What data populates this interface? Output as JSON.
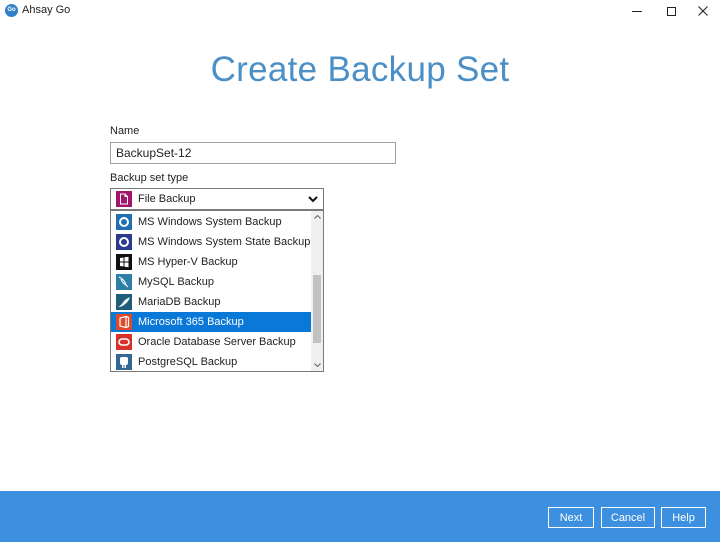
{
  "window": {
    "logo_text": "Go",
    "title": "Ahsay Go"
  },
  "page": {
    "title": "Create Backup Set"
  },
  "form": {
    "name_label": "Name",
    "name_value": "BackupSet-12",
    "type_label": "Backup set type",
    "type_selected": "File Backup",
    "type_selected_icon": "file-icon"
  },
  "dropdown": {
    "options": [
      {
        "label": "MS Windows System Backup",
        "icon": "windows-system-icon",
        "selected": false
      },
      {
        "label": "MS Windows System State Backup",
        "icon": "windows-system-state-icon",
        "selected": false
      },
      {
        "label": "MS Hyper-V Backup",
        "icon": "hyper-v-icon",
        "selected": false
      },
      {
        "label": "MySQL Backup",
        "icon": "mysql-dolphin-icon",
        "selected": false
      },
      {
        "label": "MariaDB Backup",
        "icon": "mariadb-seal-icon",
        "selected": false
      },
      {
        "label": "Microsoft 365 Backup",
        "icon": "microsoft-365-icon",
        "selected": true
      },
      {
        "label": "Oracle Database Server Backup",
        "icon": "oracle-icon",
        "selected": false
      },
      {
        "label": "PostgreSQL Backup",
        "icon": "postgresql-elephant-icon",
        "selected": false
      }
    ]
  },
  "footer": {
    "next_label": "Next",
    "cancel_label": "Cancel",
    "help_label": "Help"
  },
  "colors": {
    "title_blue": "#4a8fc6",
    "footer_blue": "#3d8fdf",
    "selection_blue": "#0a78d7"
  }
}
